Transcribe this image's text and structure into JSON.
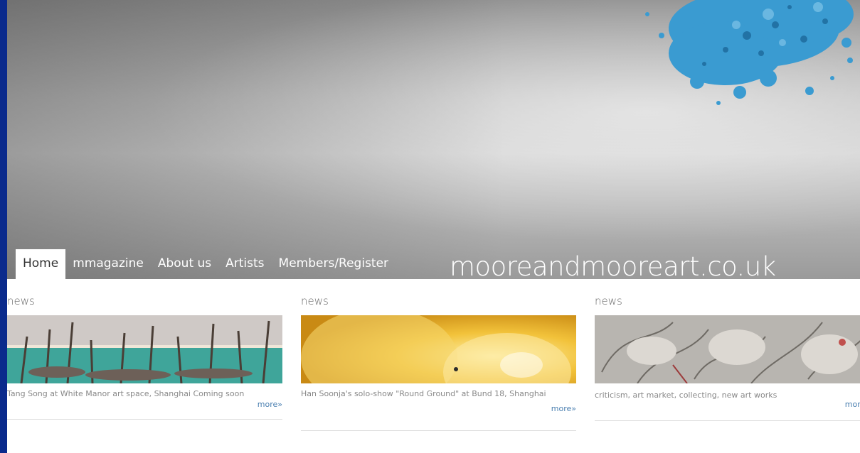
{
  "site": {
    "title": "mooreandmooreart.co.uk"
  },
  "nav": {
    "items": [
      {
        "label": "Home",
        "active": true
      },
      {
        "label": "mmagazine",
        "active": false
      },
      {
        "label": "About us",
        "active": false
      },
      {
        "label": "Artists",
        "active": false
      },
      {
        "label": "Members/Register",
        "active": false
      }
    ]
  },
  "columns": [
    {
      "heading": "news",
      "text": "Tang Song at White Manor art space, Shanghai",
      "text_suffix": "Coming soon",
      "more_label": "more»"
    },
    {
      "heading": "news",
      "text": "Han Soonja's solo-show \"Round Ground\" at Bund 18, Shanghai",
      "more_label": "more»"
    },
    {
      "heading": "news",
      "text": "criticism, art market, collecting, new art works",
      "more_label": "more»"
    }
  ],
  "colors": {
    "frame": "#0a2a8c",
    "nav_text": "#ffffff",
    "link": "#4a7fb0",
    "pigment": "#3a9bd1"
  },
  "icons": {
    "hero": "blue-pigment-image"
  }
}
